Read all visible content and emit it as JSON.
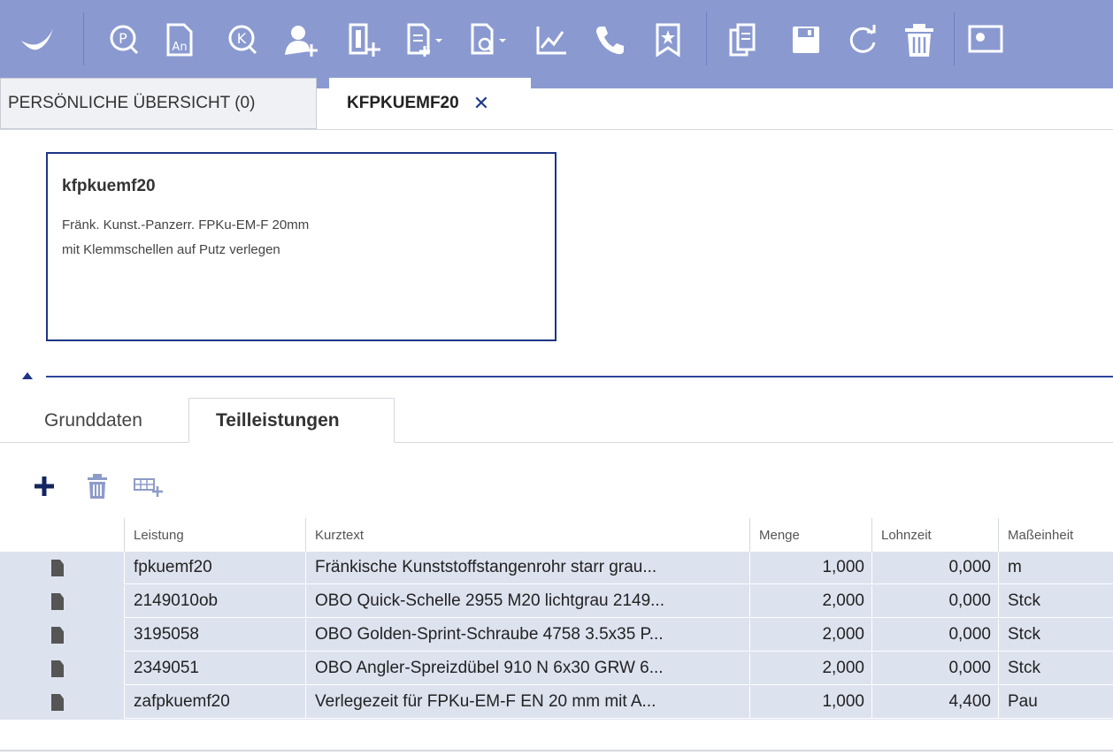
{
  "toolbar": {
    "icons": [
      "checkmark-logo-icon",
      "p-circle-search-icon",
      "an-document-icon",
      "k-circle-search-icon",
      "add-person-icon",
      "add-document-icon",
      "new-document-dropdown-icon",
      "search-document-dropdown-icon",
      "line-chart-icon",
      "phone-icon",
      "bookmark-star-icon",
      "copy-document-icon",
      "save-icon",
      "refresh-icon",
      "trash-icon",
      "cropped-icon"
    ],
    "color": "#8a9ad0"
  },
  "tabs": {
    "overview_label": "PERSÖNLICHE ÜBERSICHT (0)",
    "active_label": "KFPKUEMF20",
    "close_label": "✕"
  },
  "card": {
    "title": "kfpkuemf20",
    "line1": "Fränk. Kunst.-Panzerr. FPKu-EM-F 20mm",
    "line2": "mit Klemmschellen auf Putz verlegen"
  },
  "subtabs": {
    "grunddaten": "Grunddaten",
    "teilleistungen": "Teilleistungen"
  },
  "actions": {
    "add": "add-icon",
    "delete": "trash-icon",
    "insert": "insert-table-row-icon"
  },
  "table": {
    "headers": {
      "leistung": "Leistung",
      "kurztext": "Kurztext",
      "menge": "Menge",
      "lohnzeit": "Lohnzeit",
      "masseinheit": "Maßeinheit"
    },
    "rows": [
      {
        "leistung": "fpkuemf20",
        "kurztext": "Fränkische Kunststoffstangenrohr starr grau...",
        "menge": "1,000",
        "lohnzeit": "0,000",
        "einheit": "m"
      },
      {
        "leistung": "2149010ob",
        "kurztext": "OBO Quick-Schelle 2955 M20 lichtgrau 2149...",
        "menge": "2,000",
        "lohnzeit": "0,000",
        "einheit": "Stck"
      },
      {
        "leistung": "3195058",
        "kurztext": "OBO Golden-Sprint-Schraube 4758 3.5x35 P...",
        "menge": "2,000",
        "lohnzeit": "0,000",
        "einheit": "Stck"
      },
      {
        "leistung": "2349051",
        "kurztext": "OBO Angler-Spreizdübel 910 N 6x30 GRW 6...",
        "menge": "2,000",
        "lohnzeit": "0,000",
        "einheit": "Stck"
      },
      {
        "leistung": "zafpkuemf20",
        "kurztext": "Verlegezeit für FPKu-EM-F EN 20 mm mit A...",
        "menge": "1,000",
        "lohnzeit": "4,400",
        "einheit": "Pau"
      }
    ],
    "row_color": "#dde2ef"
  }
}
